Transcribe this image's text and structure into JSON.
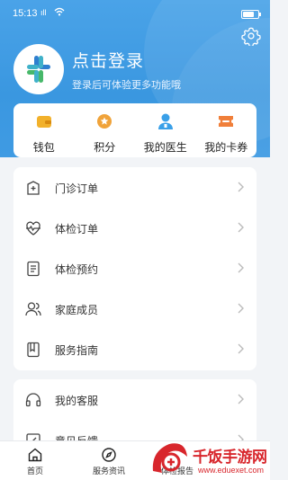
{
  "status_bar": {
    "time": "15:13",
    "signal": "ıll"
  },
  "profile": {
    "title": "点击登录",
    "subtitle": "登录后可体验更多功能哦"
  },
  "quick_actions": [
    {
      "label": "钱包",
      "icon": "wallet-icon",
      "color": "#f2b12b"
    },
    {
      "label": "积分",
      "icon": "points-icon",
      "color": "#f0a33a"
    },
    {
      "label": "我的医生",
      "icon": "doctor-icon",
      "color": "#3aa0e8"
    },
    {
      "label": "我的卡券",
      "icon": "coupon-icon",
      "color": "#f07f3a"
    }
  ],
  "menu_main": [
    {
      "label": "门诊订单",
      "icon": "hospital-order-icon"
    },
    {
      "label": "体检订单",
      "icon": "heartbeat-icon"
    },
    {
      "label": "体检预约",
      "icon": "document-icon"
    },
    {
      "label": "家庭成员",
      "icon": "family-icon"
    },
    {
      "label": "服务指南",
      "icon": "guide-book-icon"
    }
  ],
  "menu_secondary": [
    {
      "label": "我的客服",
      "icon": "headset-icon"
    },
    {
      "label": "意见反馈",
      "icon": "feedback-icon"
    }
  ],
  "tab_bar": [
    {
      "label": "首页",
      "icon": "home-icon"
    },
    {
      "label": "服务资讯",
      "icon": "compass-icon"
    },
    {
      "label": "体检报告",
      "icon": "report-icon"
    }
  ],
  "watermark": {
    "name": "千饭手游网",
    "url": "www.eduexet.com"
  },
  "colors": {
    "header": "#3a97e0",
    "accent": "#3aa0e8",
    "background": "#f2f4f7"
  }
}
